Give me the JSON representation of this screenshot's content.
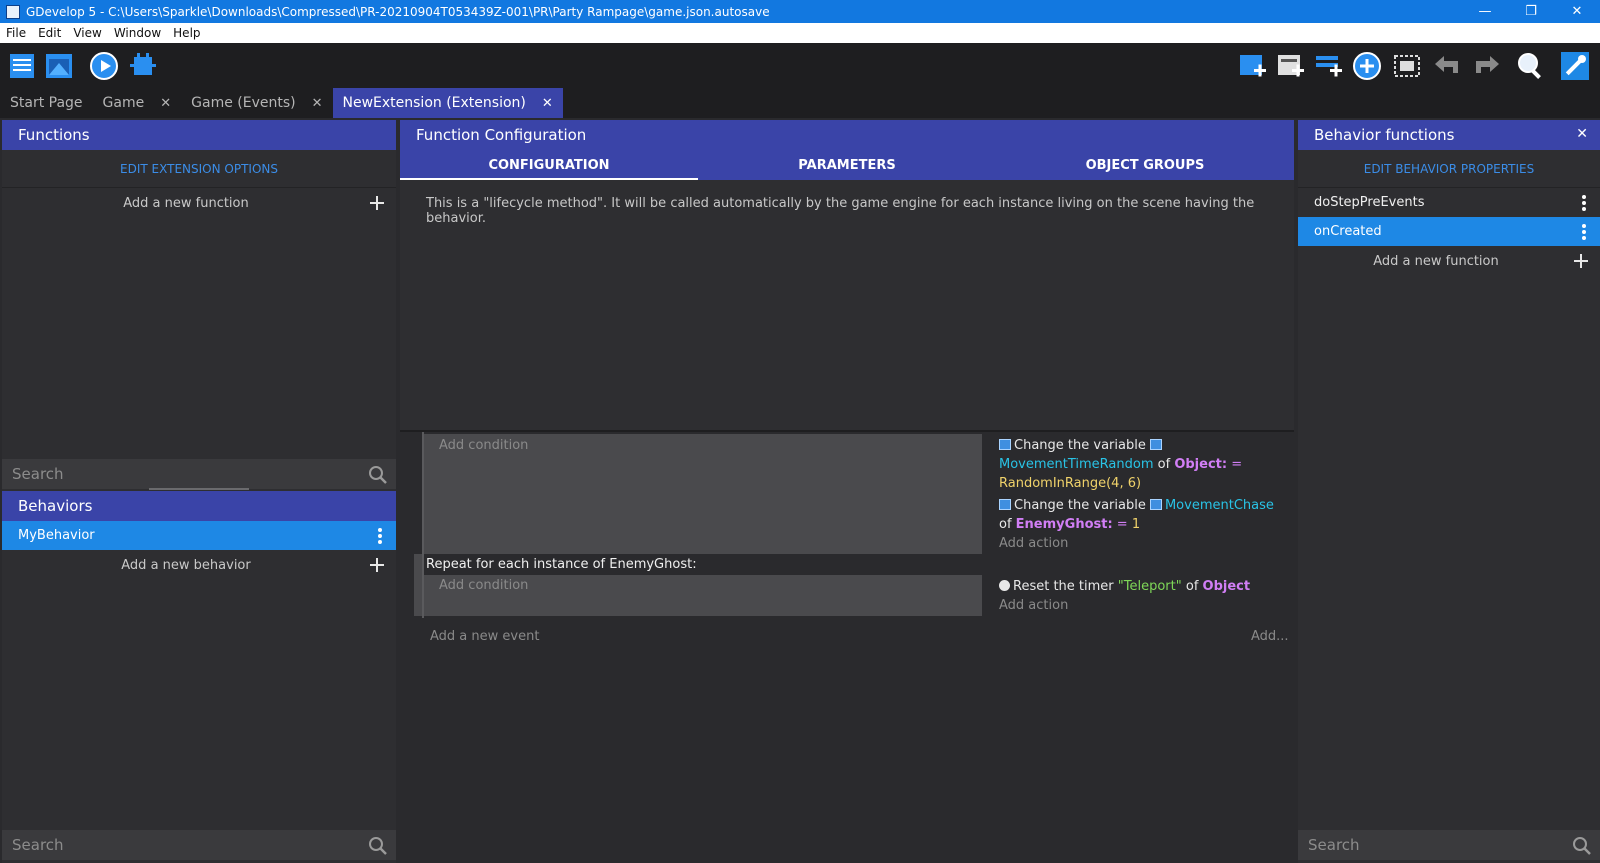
{
  "window": {
    "title": "GDevelop 5 - C:\\Users\\Sparkle\\Downloads\\Compressed\\PR-20210904T053439Z-001\\PR\\Party Rampage\\game.json.autosave",
    "minimize": "—",
    "maximize": "❐",
    "close": "✕"
  },
  "menu": {
    "file": "File",
    "edit": "Edit",
    "view": "View",
    "window": "Window",
    "help": "Help"
  },
  "tabs": [
    {
      "label": "Start Page"
    },
    {
      "label": "Game",
      "close": "✕"
    },
    {
      "label": "Game (Events)",
      "close": "✕"
    },
    {
      "label": "NewExtension (Extension)",
      "close": "✕"
    }
  ],
  "functions_panel": {
    "title": "Functions",
    "edit_options": "EDIT EXTENSION OPTIONS",
    "add_function": "Add a new function",
    "search_placeholder": "Search",
    "behaviors_title": "Behaviors",
    "behaviors": [
      {
        "name": "MyBehavior"
      }
    ],
    "add_behavior": "Add a new behavior",
    "bottom_search": "Search"
  },
  "config_panel": {
    "title": "Function Configuration",
    "tabs": [
      "CONFIGURATION",
      "PARAMETERS",
      "OBJECT GROUPS"
    ],
    "lifecycle_text": "This is a \"lifecycle method\". It will be called automatically by the game engine for each instance living on the scene having the behavior."
  },
  "events": {
    "add_condition": "Add condition",
    "add_action": "Add action",
    "action1": {
      "prefix": "Change the variable",
      "variable": "MovementTimeRandom",
      "of": "of",
      "object": "Object:",
      "eq": "=",
      "expr": "RandomInRange(4, 6)"
    },
    "action2": {
      "prefix": "Change the variable",
      "variable": "MovementChase",
      "of": "of",
      "object": "EnemyGhost:",
      "eq": "=",
      "expr": "1"
    },
    "repeat": "Repeat for each instance of EnemyGhost:",
    "action3": {
      "prefix": "Reset the timer",
      "timer": "\"Teleport\"",
      "of": "of",
      "object": "Object"
    },
    "add_event": "Add a new event",
    "add_more": "Add..."
  },
  "behavior_panel": {
    "title": "Behavior functions",
    "close": "✕",
    "edit_props": "EDIT BEHAVIOR PROPERTIES",
    "functions": [
      {
        "name": "doStepPreEvents"
      },
      {
        "name": "onCreated"
      }
    ],
    "add_function": "Add a new function",
    "search_placeholder": "Search"
  },
  "colors": {
    "accent": "#3a44a8",
    "selected": "#1e88e5",
    "titlebar": "#1278e0"
  }
}
